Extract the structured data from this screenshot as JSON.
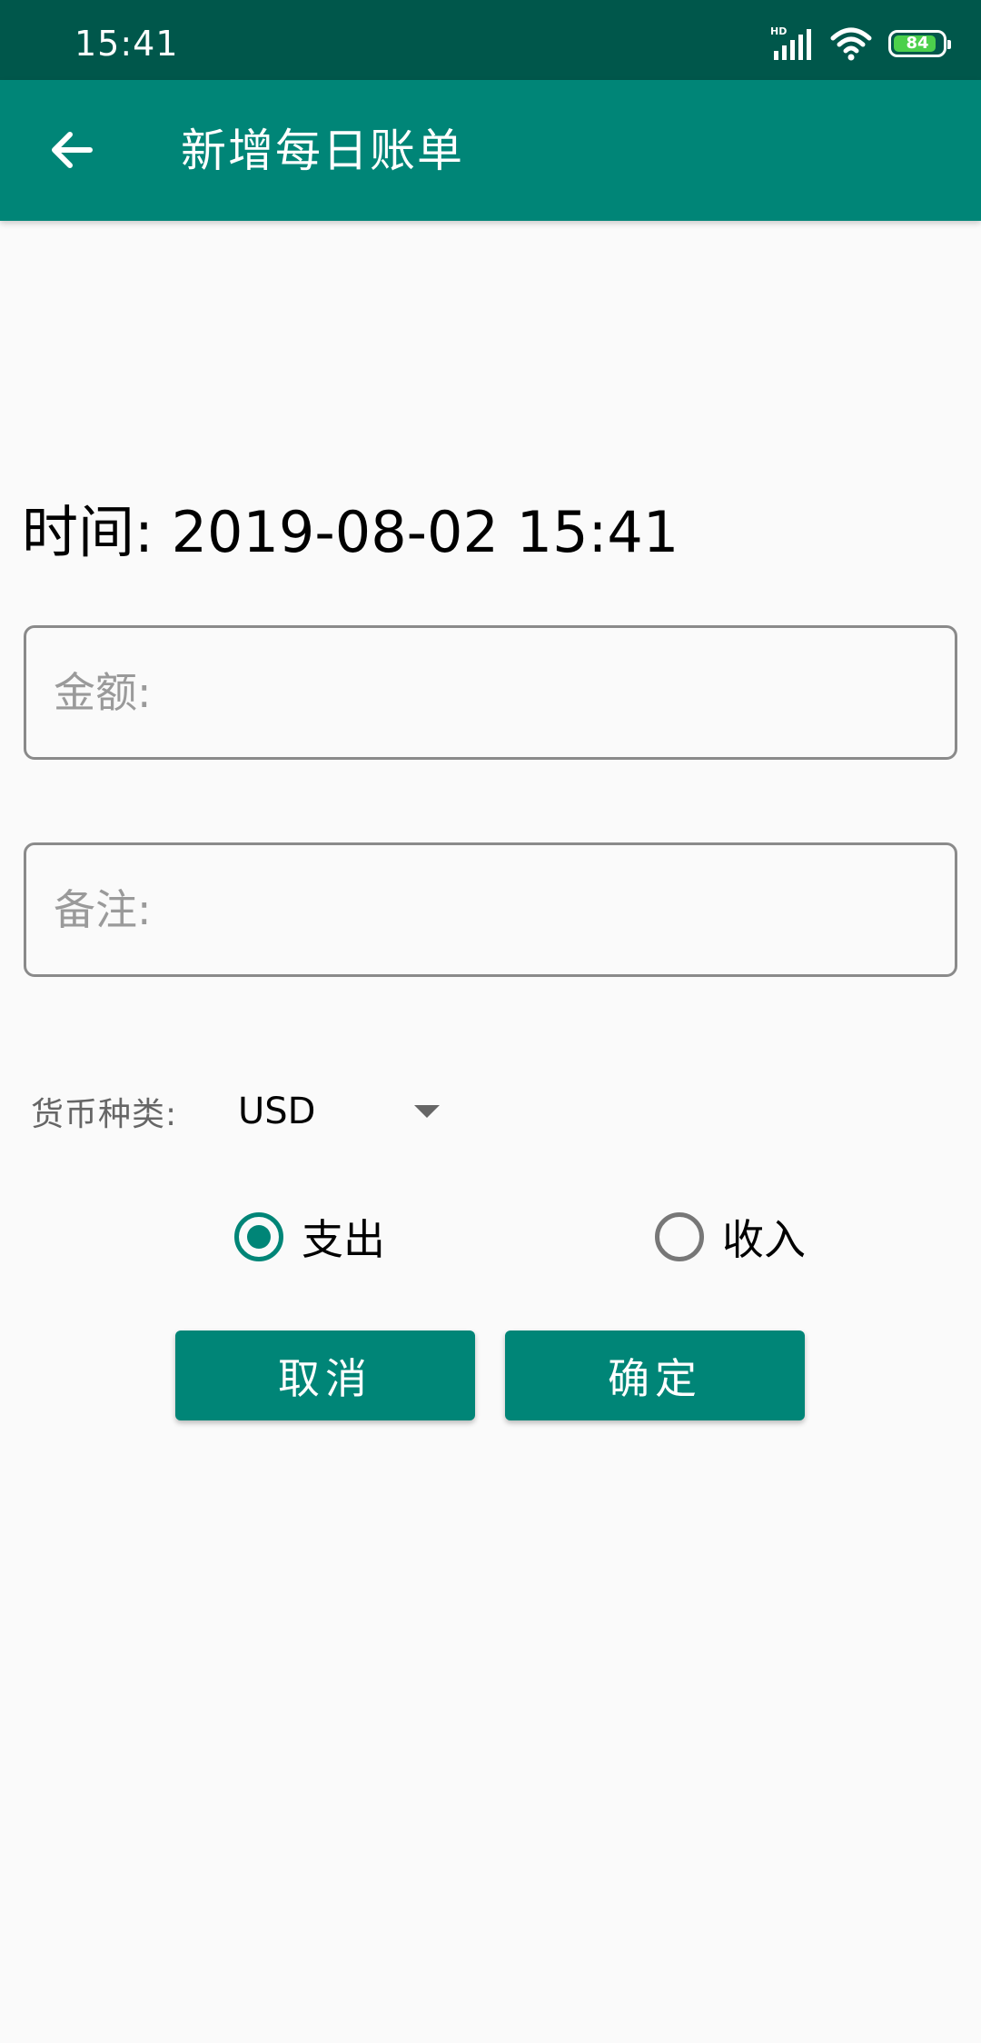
{
  "status_bar": {
    "time": "15:41",
    "battery_level": "84",
    "network_label": "HD",
    "icons": [
      "signal-icon",
      "wifi-icon",
      "battery-icon"
    ]
  },
  "app_bar": {
    "title": "新增每日账单",
    "back_icon": "arrow-back-icon"
  },
  "form": {
    "time_label": "时间: 2019-08-02 15:41",
    "amount": {
      "value": "",
      "placeholder": "金额:"
    },
    "note": {
      "value": "",
      "placeholder": "备注:"
    },
    "currency": {
      "label": "货币种类:",
      "selected": "USD"
    },
    "type": {
      "options": [
        {
          "label": "支出",
          "checked": true
        },
        {
          "label": "收入",
          "checked": false
        }
      ]
    },
    "buttons": {
      "cancel": "取消",
      "confirm": "确定"
    }
  },
  "colors": {
    "status_bar": "#00574b",
    "primary": "#008577",
    "background": "#fafafa",
    "battery_fill": "#4cd04c"
  }
}
